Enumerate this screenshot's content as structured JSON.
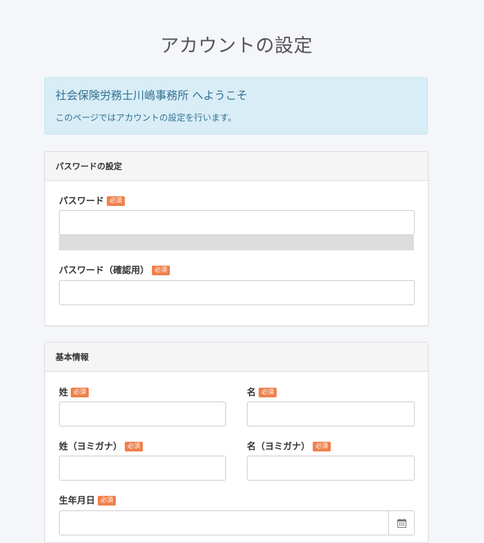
{
  "page": {
    "title": "アカウントの設定"
  },
  "alert": {
    "title": "社会保険労務士川嶋事務所 へようこそ",
    "text": "このページではアカウントの設定を行います。"
  },
  "password_panel": {
    "heading": "パスワードの設定",
    "password_label": "パスワード",
    "password_confirm_label": "パスワード（確認用）",
    "password_value": "",
    "password_confirm_value": "",
    "strength": 0
  },
  "basic_panel": {
    "heading": "基本情報",
    "last_name_label": "姓",
    "first_name_label": "名",
    "last_name_kana_label": "姓（ヨミガナ）",
    "first_name_kana_label": "名（ヨミガナ）",
    "birthdate_label": "生年月日",
    "last_name_value": "",
    "first_name_value": "",
    "last_name_kana_value": "",
    "first_name_kana_value": "",
    "birthdate_value": ""
  },
  "badges": {
    "required": "必須"
  },
  "icons": {
    "calendar": "calendar-icon"
  },
  "colors": {
    "background": "#f4f6fa",
    "alert_bg": "#d9edf7",
    "alert_text": "#31708f",
    "required_badge": "#f0804b"
  }
}
